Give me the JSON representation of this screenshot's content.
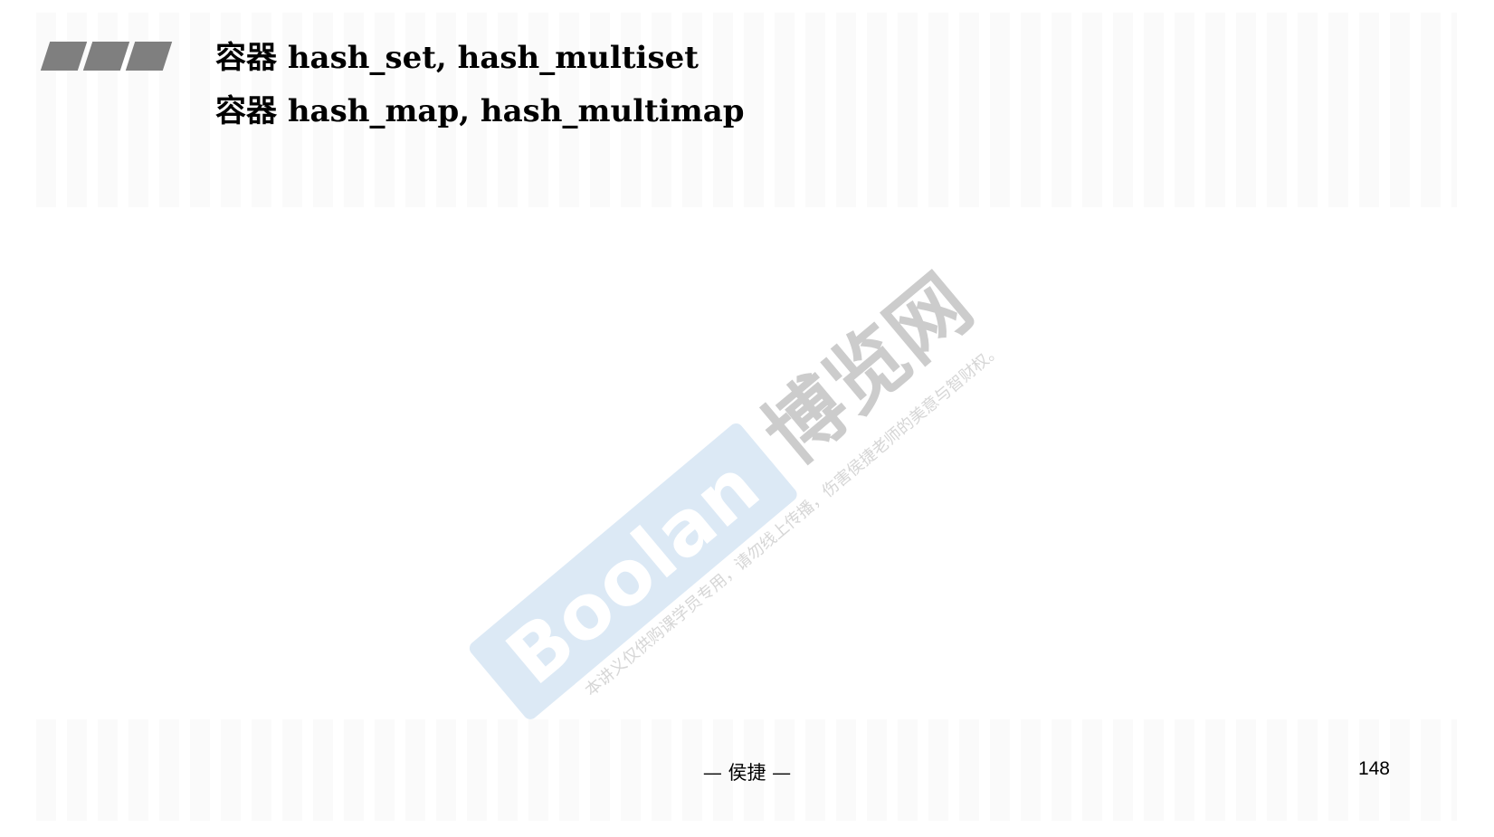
{
  "slide": {
    "title_line1": "容器 hash_set, hash_multiset",
    "title_line2": "容器 hash_map, hash_multimap",
    "footer_author": "— 侯捷 —",
    "page_number": "148"
  },
  "watermark": {
    "logo_text": "Boolan",
    "brand_cn": "博览网",
    "notice": "本讲义仅供购课学员专用，请勿线上传播，伤害侯捷老师的美意与智财权。"
  },
  "colors": {
    "decor_gray": "#7f7f7f",
    "watermark_blue": "#dce9f5",
    "watermark_gray": "#cccccc"
  }
}
